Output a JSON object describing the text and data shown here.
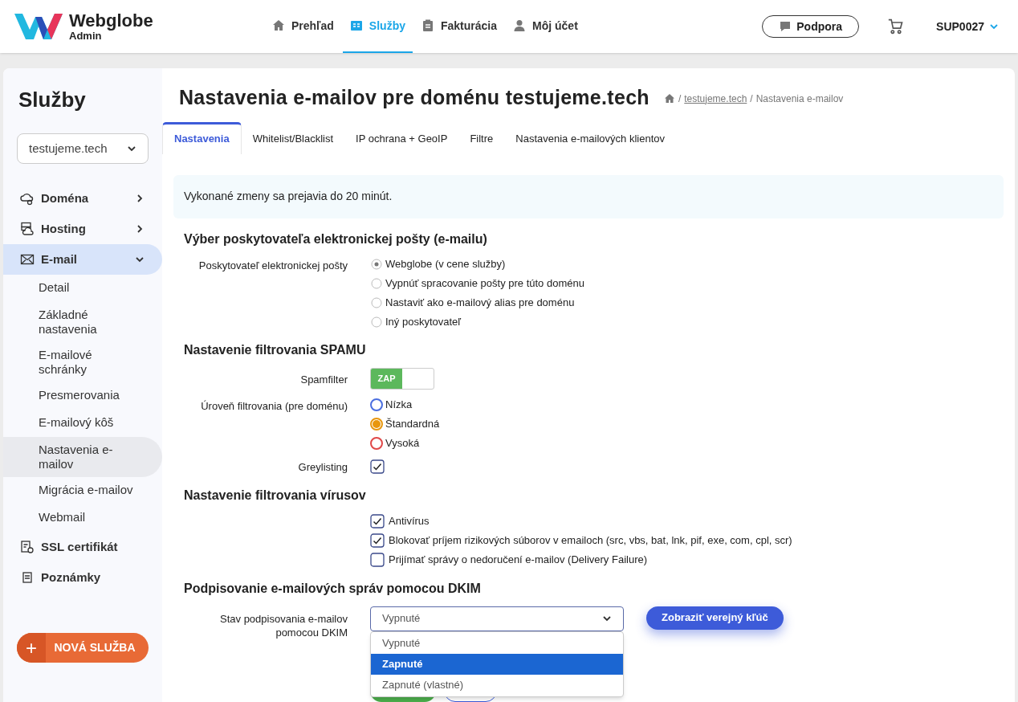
{
  "header": {
    "logo": {
      "name": "Webglobe",
      "subtitle": "Admin"
    },
    "nav": [
      {
        "label": "Prehľad",
        "selected": false
      },
      {
        "label": "Služby",
        "selected": true
      },
      {
        "label": "Fakturácia",
        "selected": false
      },
      {
        "label": "Môj účet",
        "selected": false
      }
    ],
    "support_button": "Podpora",
    "account": "SUP0027"
  },
  "sidebar": {
    "title": "Služby",
    "domain_select": "testujeme.tech",
    "items": [
      {
        "label": "Doména",
        "expanded": false,
        "selected": false
      },
      {
        "label": "Hosting",
        "expanded": false,
        "selected": false
      },
      {
        "label": "E-mail",
        "expanded": true,
        "selected": true,
        "children": [
          {
            "label": "Detail",
            "selected": false
          },
          {
            "label": "Základné nastavenia",
            "selected": false
          },
          {
            "label": "E-mailové schránky",
            "selected": false
          },
          {
            "label": "Presmerovania",
            "selected": false
          },
          {
            "label": "E-mailový kôš",
            "selected": false
          },
          {
            "label": "Nastavenia e-mailov",
            "selected": true
          },
          {
            "label": "Migrácia e-mailov",
            "selected": false
          },
          {
            "label": "Webmail",
            "selected": false
          }
        ]
      },
      {
        "label": "SSL certifikát",
        "selected": false
      },
      {
        "label": "Poznámky",
        "selected": false
      }
    ],
    "new_button": {
      "icon": "+",
      "label": "NOVÁ SLUŽBA"
    }
  },
  "page": {
    "title": "Nastavenia e-mailov pre doménu testujeme.tech",
    "breadcrumb": [
      {
        "separator": "/",
        "label": "testujeme.tech",
        "link": true
      },
      {
        "separator": "/",
        "label": "Nastavenia e-mailov",
        "link": false
      }
    ],
    "tabs": [
      {
        "label": "Nastavenia",
        "selected": true
      },
      {
        "label": "Whitelist/Blacklist",
        "selected": false
      },
      {
        "label": "IP ochrana + GeoIP",
        "selected": false
      },
      {
        "label": "Filtre",
        "selected": false
      },
      {
        "label": "Nastavenia e-mailových klientov",
        "selected": false
      }
    ],
    "notice": "Vykonané zmeny sa prejavia do 20 minút.",
    "sections": [
      {
        "heading": "Výber poskytovateľa elektronickej pošty (e-mailu)",
        "rows": [
          {
            "kind": "radio",
            "label": "Poskytovateľ elektronickej pošty",
            "options": [
              {
                "label": "Webglobe (v cene služby)",
                "selected": true
              },
              {
                "label": "Vypnúť spracovanie pošty pre túto doménu",
                "selected": false
              },
              {
                "label": "Nastaviť ako e-mailový alias pre doménu",
                "selected": false
              },
              {
                "label": "Iný poskytovateľ",
                "selected": false
              }
            ]
          }
        ]
      },
      {
        "heading": "Nastavenie filtrovania SPAMU",
        "rows": [
          {
            "kind": "toggle",
            "label": "Spamfilter",
            "on": true,
            "on_text": "ZAP"
          },
          {
            "kind": "radio",
            "label": "Úroveň filtrovania (pre doménu)",
            "options": [
              {
                "label": "Nízka",
                "selected": false,
                "color": "#4a6ee0"
              },
              {
                "label": "Štandardná",
                "selected": true,
                "color": "#e8960c"
              },
              {
                "label": "Vysoká",
                "selected": false,
                "color": "#e04848"
              }
            ]
          },
          {
            "kind": "checkbox",
            "label": "Greylisting",
            "options": [
              {
                "checked": true
              }
            ]
          }
        ]
      },
      {
        "heading": "Nastavenie filtrovania vírusov",
        "rows": [
          {
            "kind": "checkbox",
            "options": [
              {
                "label": "Antivírus",
                "checked": true
              },
              {
                "label": "Blokovať príjem rizikových súborov v emailoch (src, vbs, bat, lnk, pif, exe, com, cpl, scr)",
                "checked": true
              },
              {
                "label": "Prijímať správy o nedoručení e-mailov (Delivery Failure)",
                "checked": false
              }
            ]
          }
        ]
      },
      {
        "heading": "Podpisovanie e-mailových správ pomocou DKIM",
        "rows": [
          {
            "kind": "select",
            "label": "Stav podpisovania e-mailov pomocou DKIM",
            "value": "Vypnuté",
            "expanded": true,
            "options": [
              {
                "label": "Vypnuté",
                "highlighted": false
              },
              {
                "label": "Zapnuté",
                "highlighted": true
              },
              {
                "label": "Zapnuté (vlastné)",
                "highlighted": false
              }
            ],
            "button": "Zobraziť verejný kľúč"
          }
        ]
      }
    ]
  }
}
